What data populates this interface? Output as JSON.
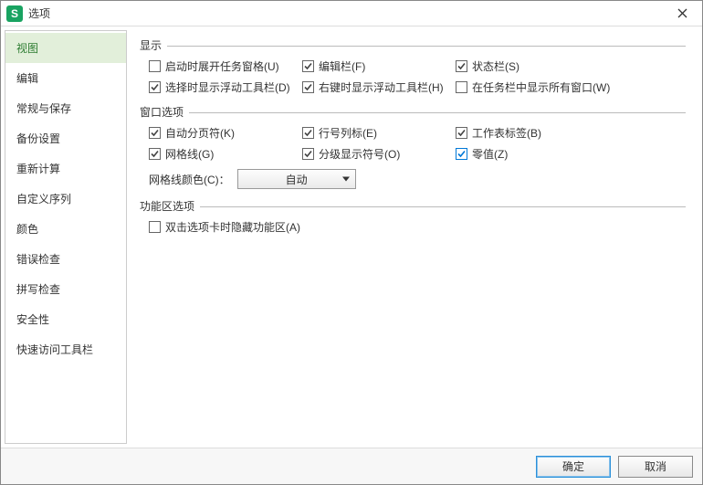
{
  "title": "选项",
  "app_icon_letter": "S",
  "sidebar": {
    "items": [
      {
        "label": "视图"
      },
      {
        "label": "编辑"
      },
      {
        "label": "常规与保存"
      },
      {
        "label": "备份设置"
      },
      {
        "label": "重新计算"
      },
      {
        "label": "自定义序列"
      },
      {
        "label": "颜色"
      },
      {
        "label": "错误检查"
      },
      {
        "label": "拼写检查"
      },
      {
        "label": "安全性"
      },
      {
        "label": "快速访问工具栏"
      }
    ],
    "selected_index": 0
  },
  "groups": {
    "display": {
      "title": "显示",
      "items": [
        {
          "label": "启动时展开任务窗格(U)",
          "checked": false
        },
        {
          "label": "编辑栏(F)",
          "checked": true
        },
        {
          "label": "状态栏(S)",
          "checked": true
        },
        {
          "label": "选择时显示浮动工具栏(D)",
          "checked": true
        },
        {
          "label": "右键时显示浮动工具栏(H)",
          "checked": true
        },
        {
          "label": "在任务栏中显示所有窗口(W)",
          "checked": false
        }
      ]
    },
    "window": {
      "title": "窗口选项",
      "items": [
        {
          "label": "自动分页符(K)",
          "checked": true
        },
        {
          "label": "行号列标(E)",
          "checked": true
        },
        {
          "label": "工作表标签(B)",
          "checked": true
        },
        {
          "label": "网格线(G)",
          "checked": true
        },
        {
          "label": "分级显示符号(O)",
          "checked": true
        },
        {
          "label": "零值(Z)",
          "checked": true,
          "blue": true
        }
      ],
      "gridcolor_label": "网格线颜色(C)：",
      "gridcolor_value": "自动"
    },
    "ribbon": {
      "title": "功能区选项",
      "items": [
        {
          "label": "双击选项卡时隐藏功能区(A)",
          "checked": false
        }
      ]
    }
  },
  "footer": {
    "ok": "确定",
    "cancel": "取消"
  }
}
